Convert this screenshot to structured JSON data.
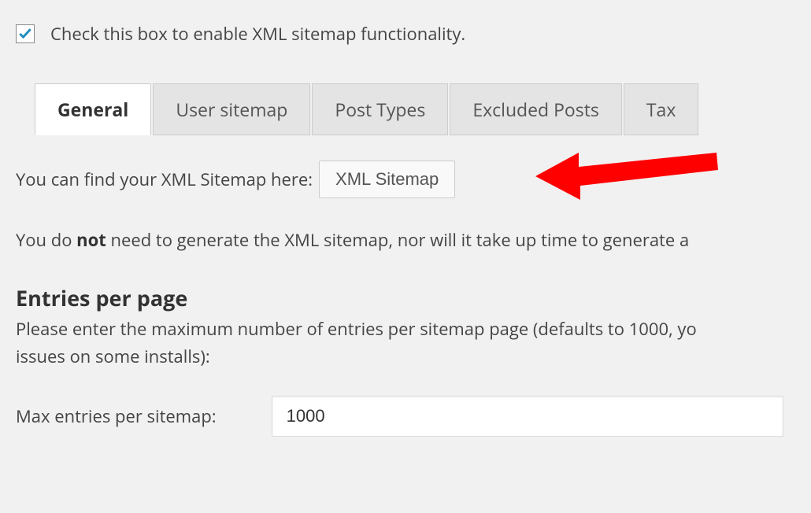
{
  "checkbox": {
    "checked": true,
    "label": "Check this box to enable XML sitemap functionality."
  },
  "tabs": [
    {
      "label": "General",
      "active": true
    },
    {
      "label": "User sitemap",
      "active": false
    },
    {
      "label": "Post Types",
      "active": false
    },
    {
      "label": "Excluded Posts",
      "active": false
    },
    {
      "label": "Tax",
      "active": false
    }
  ],
  "sitemap": {
    "prefix_text": "You can find your XML Sitemap here:",
    "button_label": "XML Sitemap"
  },
  "description": {
    "pre": "You do ",
    "bold": "not",
    "post": " need to generate the XML sitemap, nor will it take up time to generate a"
  },
  "entries": {
    "heading": "Entries per page",
    "description": "Please enter the maximum number of entries per sitemap page (defaults to 1000, yo",
    "description2": "issues on some installs):"
  },
  "max_entries": {
    "label": "Max entries per sitemap:",
    "value": "1000"
  }
}
